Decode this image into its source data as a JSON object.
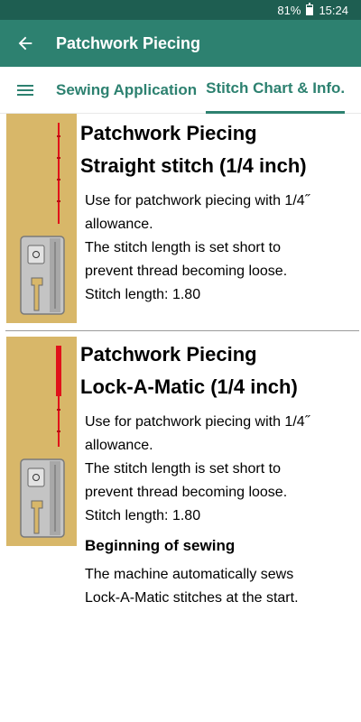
{
  "status": {
    "battery": "81%",
    "time": "15:24"
  },
  "app_bar": {
    "title": "Patchwork Piecing",
    "back_icon": "arrow-back-icon"
  },
  "tabs": [
    {
      "label": "Sewing Application",
      "selected": false
    },
    {
      "label": "Stitch Chart & Info.",
      "selected": true
    }
  ],
  "items": [
    {
      "title": "Patchwork Piecing",
      "subtitle": "Straight stitch (1/4 inch)",
      "desc_lines": [
        "Use for patchwork piecing with 1/4˝",
        "allowance.",
        "The stitch length is set short to",
        "prevent thread becoming loose.",
        "Stitch length: 1.80"
      ]
    },
    {
      "title": "Patchwork Piecing",
      "subtitle": "Lock-A-Matic (1/4 inch)",
      "desc_lines": [
        "Use for patchwork piecing with 1/4˝",
        "allowance.",
        "The stitch length is set short to",
        "prevent thread becoming loose.",
        "Stitch length: 1.80"
      ],
      "section_heading": "Beginning of sewing",
      "section_lines": [
        "The machine automatically sews",
        "Lock-A-Matic stitches at the start."
      ]
    }
  ],
  "colors": {
    "status_bar": "#1e5e51",
    "app_bar": "#2d8170",
    "accent": "#2d8170",
    "thumb_bg": "#d8b769",
    "stitch": "#e0121a"
  }
}
